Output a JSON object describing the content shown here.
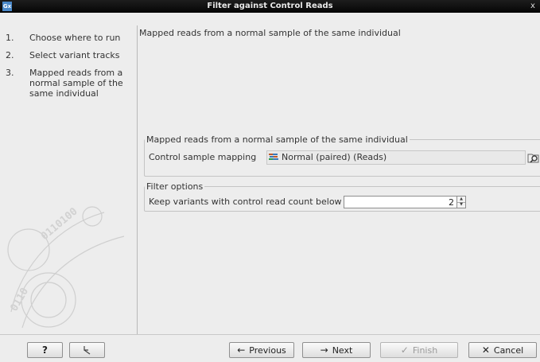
{
  "window": {
    "title": "Filter against Control Reads",
    "app_icon": "Gx",
    "close": "x"
  },
  "sidebar": {
    "steps": [
      {
        "num": "1.",
        "label": "Choose where to run"
      },
      {
        "num": "2.",
        "label": "Select variant tracks"
      },
      {
        "num": "3.",
        "label": "Mapped reads from a normal sample of the same individual"
      }
    ]
  },
  "content": {
    "title": "Mapped reads from a normal sample of the same individual",
    "group1": {
      "legend": "Mapped reads from a normal sample of the same individual",
      "mapping_label": "Control sample mapping",
      "mapping_value": "Normal (paired) (Reads)"
    },
    "group2": {
      "legend": "Filter options",
      "count_label": "Keep variants with control read count below",
      "count_value": "2"
    }
  },
  "footer": {
    "help": "?",
    "previous": "Previous",
    "next": "Next",
    "finish": "Finish",
    "cancel": "Cancel"
  },
  "icons": {
    "previous": "arrow-left-icon",
    "next": "arrow-right-icon",
    "finish": "checkmark-icon",
    "cancel": "x-icon",
    "reset": "reset-arrow-icon",
    "browse": "browse-folder-icon",
    "reads": "reads-track-icon"
  },
  "colors": {
    "titlebar": "#0a0a0a",
    "background": "#ededed",
    "accent": "#4a88c8"
  }
}
